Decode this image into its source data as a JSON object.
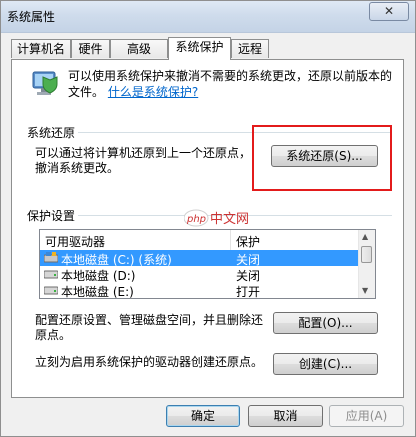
{
  "window": {
    "title": "系统属性",
    "close_label": "✕"
  },
  "tabs": [
    {
      "label": "计算机名"
    },
    {
      "label": "硬件"
    },
    {
      "label": "高级"
    },
    {
      "label": "系统保护"
    },
    {
      "label": "远程"
    }
  ],
  "intro": {
    "text": "可以使用系统保护来撤消不需要的系统更改，还原以前版本的文件。",
    "link": "什么是系统保护?"
  },
  "restore_section": {
    "label": "系统还原",
    "text_line1": "可以通过将计算机还原到上一个还原点，",
    "text_line2": "撤消系统更改。",
    "button": "系统还原(S)..."
  },
  "protection_section": {
    "label": "保护设置",
    "columns": [
      "可用驱动器",
      "保护"
    ],
    "drives": [
      {
        "name": "本地磁盘 (C:) (系统)",
        "protection": "关闭",
        "selected": true
      },
      {
        "name": "本地磁盘 (D:)",
        "protection": "关闭",
        "selected": false
      },
      {
        "name": "本地磁盘 (E:)",
        "protection": "打开",
        "selected": false
      }
    ],
    "configure_text_line1": "配置还原设置、管理磁盘空间，并且删除还",
    "configure_text_line2": "原点。",
    "configure_button": "配置(O)...",
    "create_text": "立刻为启用系统保护的驱动器创建还原点。",
    "create_button": "创建(C)..."
  },
  "footer": {
    "ok": "确定",
    "cancel": "取消",
    "apply": "应用(A)"
  },
  "watermark": {
    "text": "php 中文网"
  },
  "colors": {
    "highlight_box": "#e31b1b",
    "selection": "#3399ff",
    "link": "#0066cc"
  }
}
